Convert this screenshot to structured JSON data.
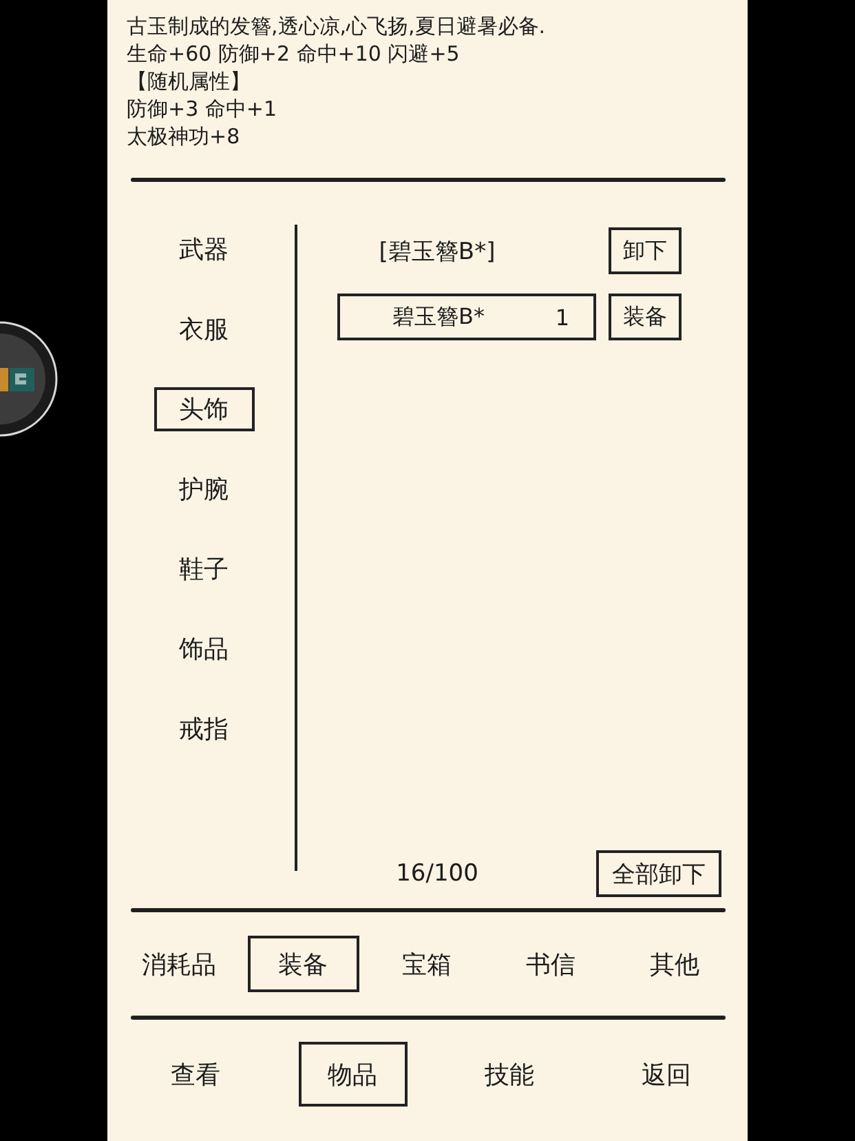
{
  "description": {
    "lines": [
      "古玉制成的发簪,透心凉,心飞扬,夏日避暑必备.",
      "生命+60 防御+2 命中+10 闪避+5",
      "【随机属性】",
      "防御+3 命中+1",
      "太极神功+8"
    ]
  },
  "categories": [
    {
      "label": "武器",
      "selected": false
    },
    {
      "label": "衣服",
      "selected": false
    },
    {
      "label": "头饰",
      "selected": true
    },
    {
      "label": "护腕",
      "selected": false
    },
    {
      "label": "鞋子",
      "selected": false
    },
    {
      "label": "饰品",
      "selected": false
    },
    {
      "label": "戒指",
      "selected": false
    }
  ],
  "equipped": {
    "label": "[碧玉簪B*]",
    "button": "卸下"
  },
  "items": [
    {
      "name": "碧玉簪B*",
      "count": "1",
      "button": "装备"
    }
  ],
  "capacity": "16/100",
  "unequip_all_button": "全部卸下",
  "item_tabs": [
    {
      "label": "消耗品",
      "selected": false
    },
    {
      "label": "装备",
      "selected": true
    },
    {
      "label": "宝箱",
      "selected": false
    },
    {
      "label": "书信",
      "selected": false
    },
    {
      "label": "其他",
      "selected": false
    }
  ],
  "nav": [
    {
      "label": "查看",
      "selected": false
    },
    {
      "label": "物品",
      "selected": true
    },
    {
      "label": "技能",
      "selected": false
    },
    {
      "label": "返回",
      "selected": false
    }
  ]
}
